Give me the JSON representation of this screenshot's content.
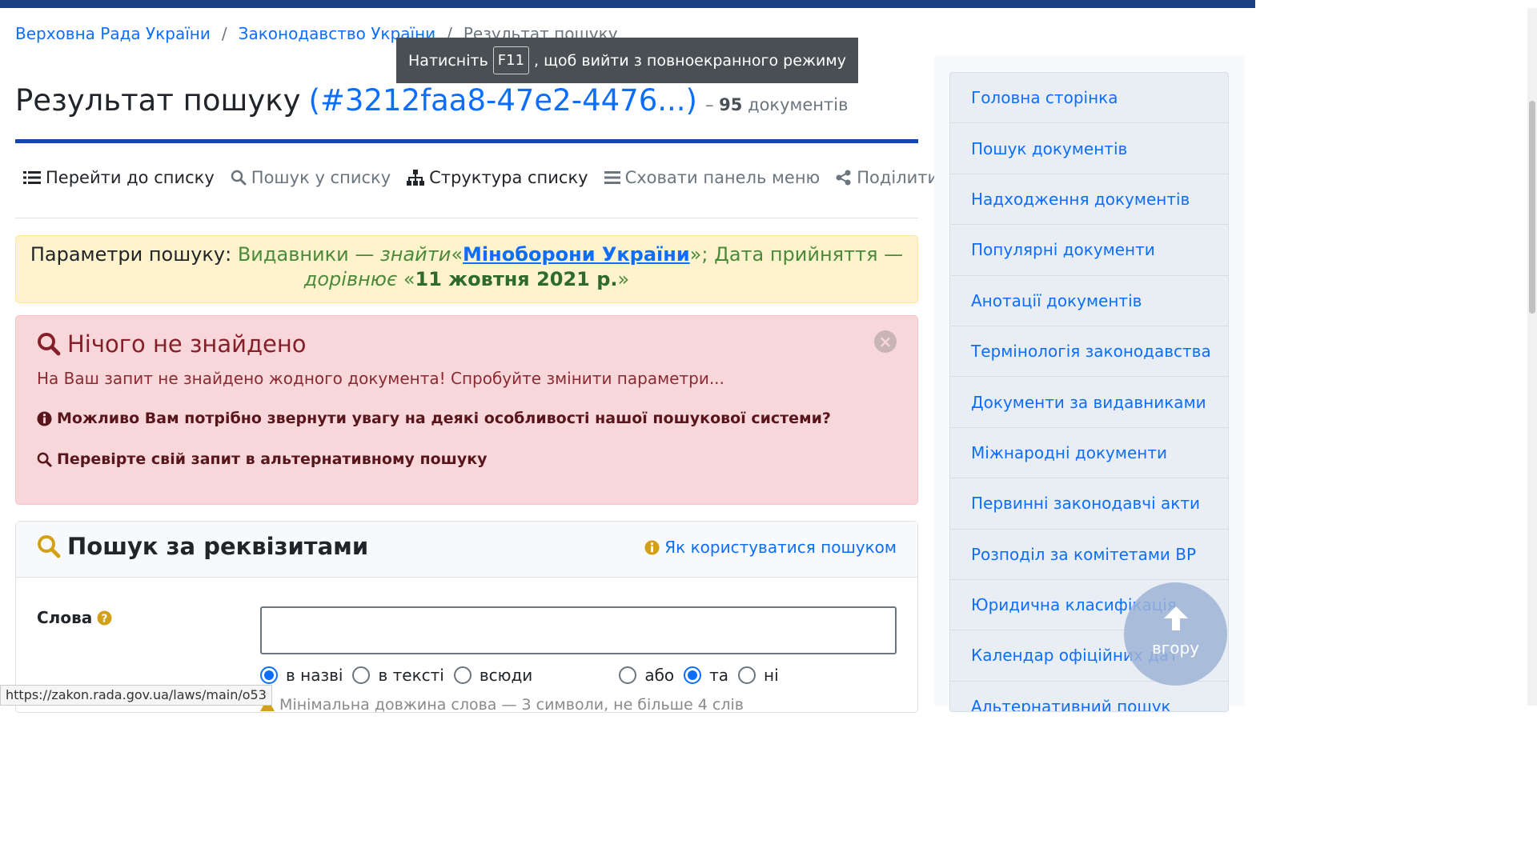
{
  "breadcrumb": {
    "items": [
      "Верховна Рада України",
      "Законодавство України"
    ],
    "separator": "/",
    "current": "Результат пошуку"
  },
  "fullscreen_toast": {
    "before": "Натисніть",
    "key": "F11",
    "after": ", щоб вийти з повноекранного режиму"
  },
  "title": {
    "text": "Результат пошуку",
    "hash": "(#3212faa8-47e2-4476...)",
    "dash": "–",
    "count": "95",
    "count_label": "документів"
  },
  "toolbar": {
    "go_to_list": "Перейти до списку",
    "search_in_list": "Пошук у списку",
    "list_structure": "Структура списку",
    "hide_menu": "Сховати панель меню",
    "share": "Поділитися"
  },
  "params": {
    "label": "Параметри пошуку:",
    "publishers": "Видавники",
    "dash": "—",
    "find": "знайти",
    "publisher_open": "«",
    "publisher": "Міноборони України",
    "publisher_close": "»;",
    "date_field": "Дата прийняття",
    "equals": "дорівнює",
    "date_open": "«",
    "date": "11 жовтня 2021 р.",
    "date_close": "»"
  },
  "alert": {
    "title": "Нічого не знайдено",
    "text": "На Ваш запит не знайдено жодного документа! Спробуйте змінити параметри...",
    "link1": "Можливо Вам потрібно звернути увагу на деякі особливості нашої пошукової системи?",
    "link2": "Перевірте свій запит в альтернативному пошуку",
    "close_glyph": "×"
  },
  "search_form": {
    "title": "Пошук за реквізитами",
    "help": "Як користуватися пошуком",
    "words_label": "Слова",
    "words_value": "",
    "scope_options": [
      "в назві",
      "в тексті",
      "всюди"
    ],
    "logic_options": [
      "або",
      "та",
      "ні"
    ],
    "hint": "Мінімальна довжина слова — 3 символи, не більше 4 слів"
  },
  "status_url": "https://zakon.rada.gov.ua/laws/main/o53",
  "sidebar": {
    "items": [
      "Головна сторінка",
      "Пошук документів",
      "Надходження документів",
      "Популярні документи",
      "Анотації документів",
      "Термінологія законодавства",
      "Документи за видавниками",
      "Міжнародні документи",
      "Первинні законодавчі акти",
      "Розподіл за комітетами ВР",
      "Юридична класифікація",
      "Календар офіційних дат",
      "Альтернативний пошук"
    ]
  },
  "up_button": {
    "label": "вгору"
  },
  "colors": {
    "accent": "#0d6efd",
    "brand_bar": "#1c3f84",
    "alert_text": "#842029",
    "param_green": "#4a8a3a"
  }
}
